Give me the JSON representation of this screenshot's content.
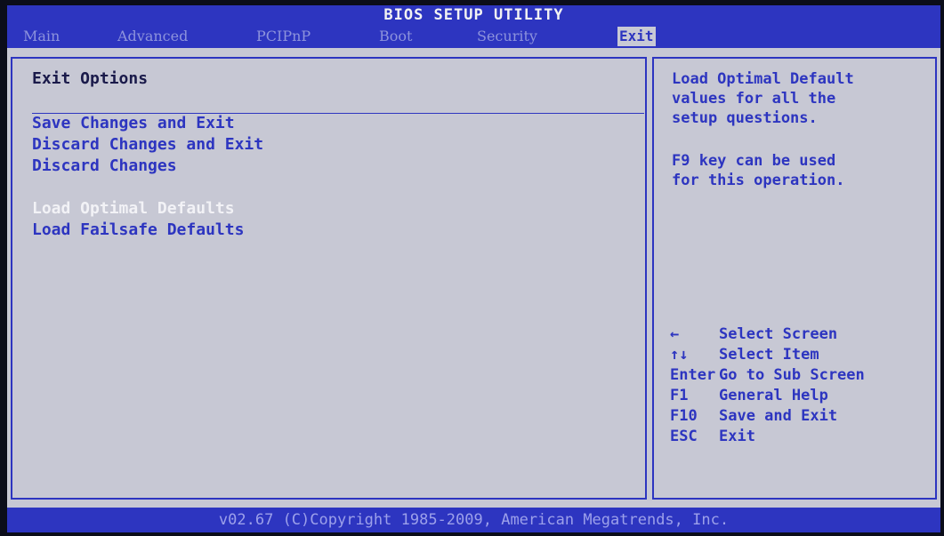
{
  "title": "BIOS SETUP UTILITY",
  "tabs": [
    {
      "label": "Main"
    },
    {
      "label": "Advanced"
    },
    {
      "label": "PCIPnP"
    },
    {
      "label": "Boot"
    },
    {
      "label": "Security"
    },
    {
      "label": "Exit"
    }
  ],
  "active_tab": "Exit",
  "left": {
    "heading": "Exit Options",
    "items": [
      {
        "label": "Save Changes and Exit"
      },
      {
        "label": "Discard Changes and Exit"
      },
      {
        "label": "Discard Changes"
      },
      {
        "label": "Load Optimal Defaults"
      },
      {
        "label": "Load Failsafe Defaults"
      }
    ],
    "selected_item": "Load Optimal Defaults"
  },
  "help": {
    "line1": "Load Optimal Default",
    "line2": "values for all the",
    "line3": "setup questions.",
    "line4": "F9 key can be used",
    "line5": "for this operation."
  },
  "keys": [
    {
      "key": "←",
      "desc": "Select Screen"
    },
    {
      "key": "↑↓",
      "desc": "Select Item"
    },
    {
      "key": "Enter",
      "desc": "Go to Sub Screen"
    },
    {
      "key": "F1",
      "desc": "General Help"
    },
    {
      "key": "F10",
      "desc": "Save and Exit"
    },
    {
      "key": "ESC",
      "desc": "Exit"
    }
  ],
  "footer": "v02.67 (C)Copyright 1985-2009, American Megatrends, Inc.",
  "colors": {
    "bios_blue": "#2d35c0",
    "background_gray": "#c7c8d4",
    "selected_text": "#f2f2f6"
  }
}
